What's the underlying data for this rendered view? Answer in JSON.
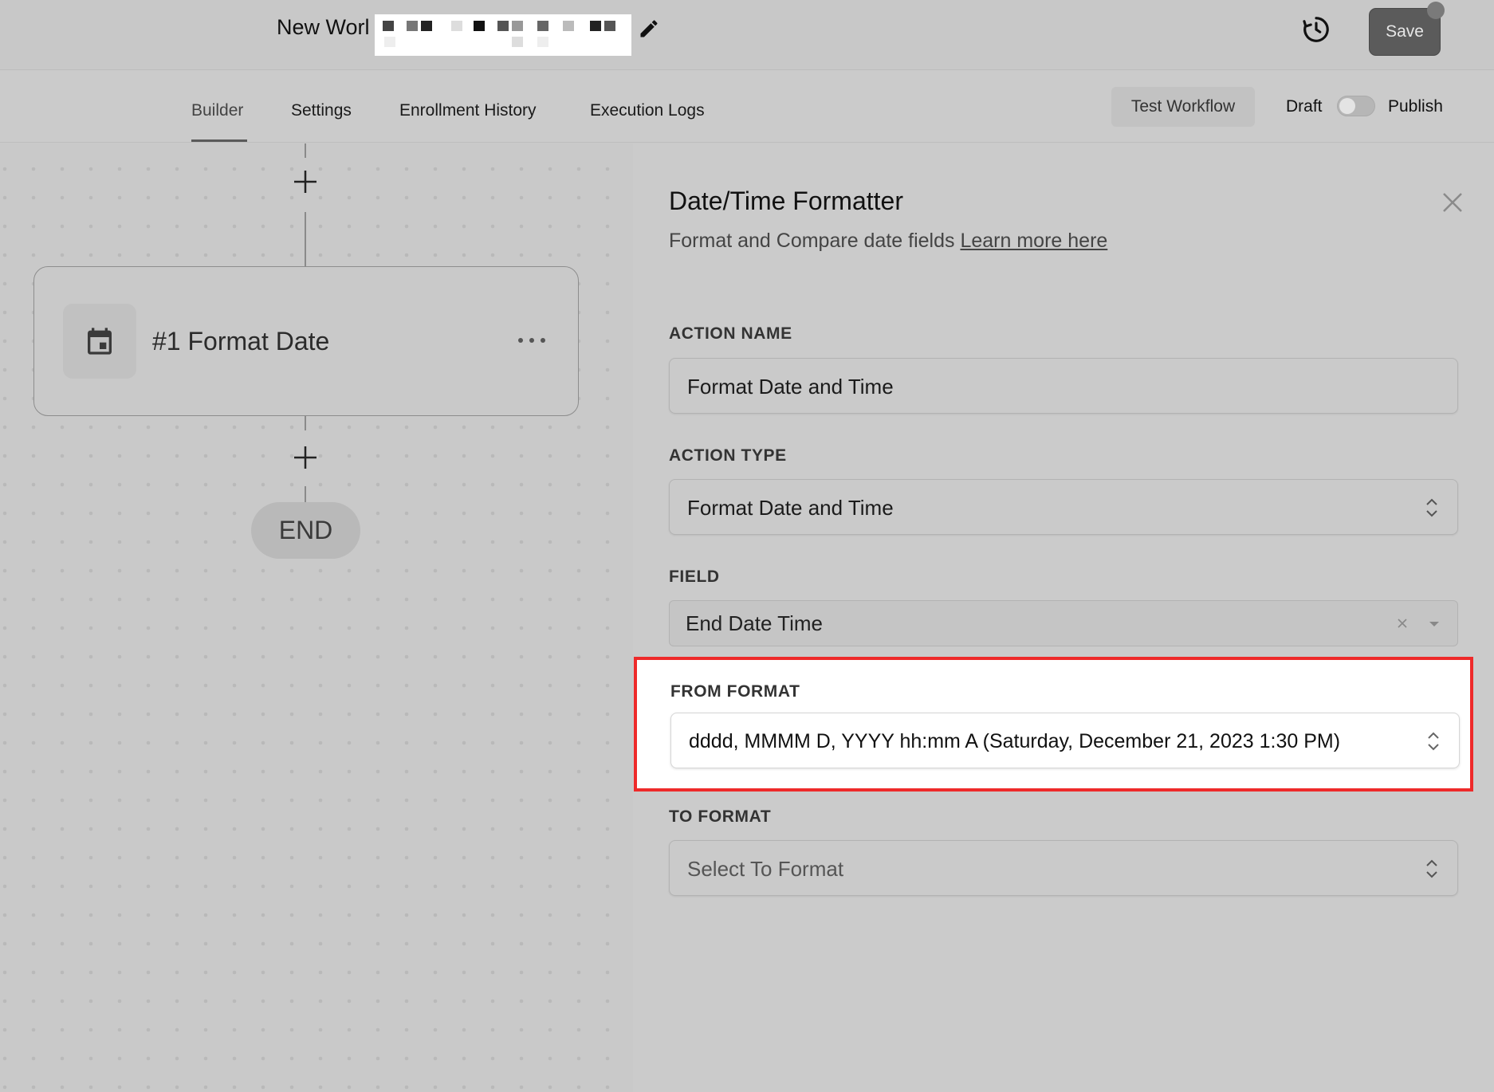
{
  "header": {
    "workflow_title": "New Worl",
    "save_label": "Save"
  },
  "tabs": [
    {
      "label": "Builder"
    },
    {
      "label": "Settings"
    },
    {
      "label": "Enrollment History"
    },
    {
      "label": "Execution Logs"
    }
  ],
  "toolbar": {
    "test_label": "Test Workflow",
    "draft_label": "Draft",
    "publish_label": "Publish"
  },
  "canvas": {
    "node_title": "#1 Format Date",
    "end_label": "END"
  },
  "panel": {
    "title": "Date/Time Formatter",
    "subtitle": "Format and Compare date fields",
    "learn_more": "Learn more here",
    "action_name_label": "ACTION NAME",
    "action_name_value": "Format Date and Time",
    "action_type_label": "ACTION TYPE",
    "action_type_value": "Format Date and Time",
    "field_label": "FIELD",
    "field_value": "End Date Time",
    "from_format_label": "FROM FORMAT",
    "from_format_value": "dddd, MMMM D, YYYY hh:mm A (Saturday, December 21, 2023 1:30 PM)",
    "to_format_label": "TO FORMAT",
    "to_format_placeholder": "Select To Format"
  },
  "colors": {
    "highlight_border": "#ee2a2a",
    "save_button": "#5b5b5b"
  }
}
